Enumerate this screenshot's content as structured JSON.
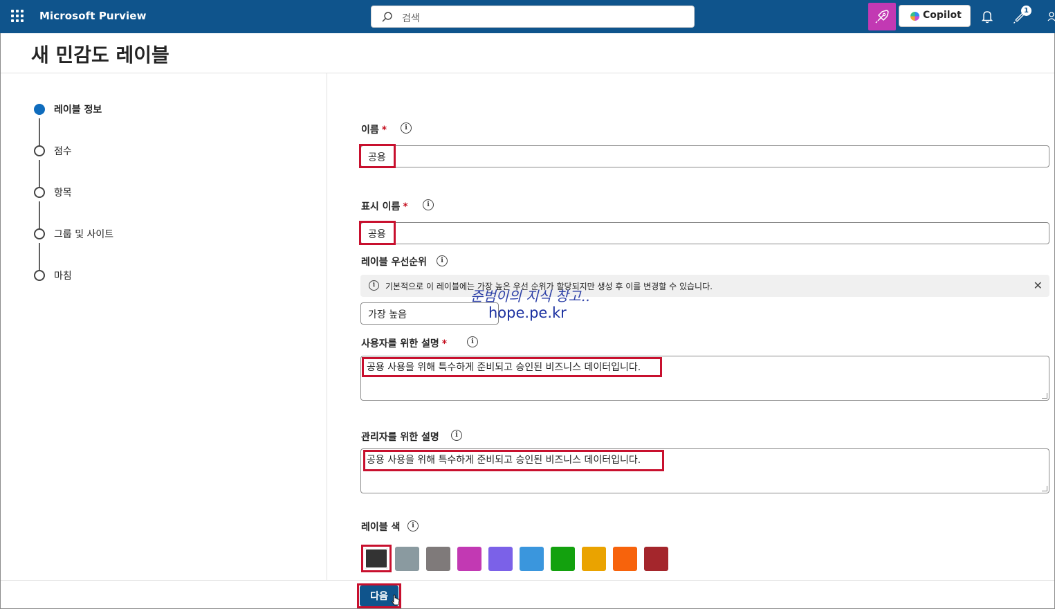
{
  "topbar": {
    "app_name": "Microsoft Purview",
    "search_placeholder": "검색",
    "copilot_label": "Copilot",
    "notification_badge": "1"
  },
  "page": {
    "title": "새 민감도 레이블"
  },
  "steps": [
    {
      "label": "레이블 정보",
      "active": true
    },
    {
      "label": "점수",
      "active": false
    },
    {
      "label": "항목",
      "active": false
    },
    {
      "label": "그룹 및 사이트",
      "active": false
    },
    {
      "label": "마침",
      "active": false
    }
  ],
  "form": {
    "name": {
      "label": "이름",
      "required": "*",
      "value": "공용"
    },
    "display_name": {
      "label": "표시 이름",
      "required": "*",
      "value": "공용"
    },
    "priority": {
      "label": "레이블 우선순위",
      "notice": "기본적으로 이 레이블에는 가장 높은 우선 순위가 할당되지만 생성 후 이를 변경할 수 있습니다.",
      "value": "가장 높음"
    },
    "user_description": {
      "label": "사용자를 위한 설명",
      "required": "*",
      "value": "공용 사용을 위해 특수하게 준비되고 승인된 비즈니스 데이터입니다."
    },
    "admin_description": {
      "label": "관리자를 위한 설명",
      "value": "공용 사용을 위해 특수하게 준비되고 승인된 비즈니스 데이터입니다."
    },
    "label_color": {
      "label": "레이블 색",
      "swatches": [
        "#333333",
        "#8a9aa0",
        "#7f7a7a",
        "#c239b3",
        "#7b61e8",
        "#3a96dd",
        "#13a10e",
        "#eaa300",
        "#f7630c",
        "#a4262c"
      ],
      "selected_index": 0
    }
  },
  "watermark": {
    "line1": "준범이의 지식 창고..",
    "line2": "hope.pe.kr"
  },
  "footer": {
    "next_label": "다음"
  }
}
